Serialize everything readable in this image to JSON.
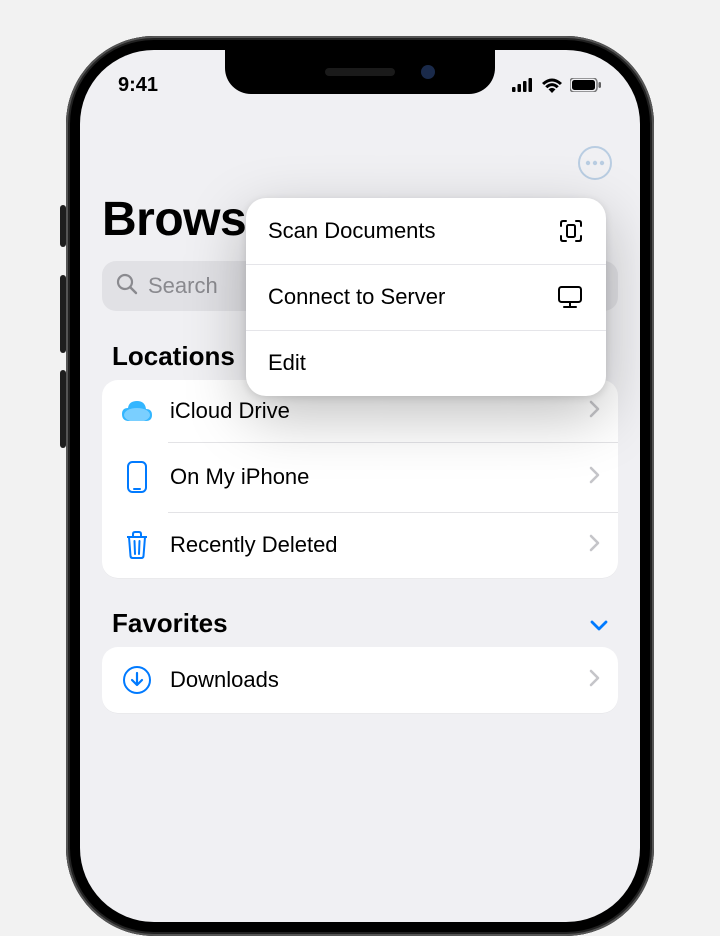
{
  "status": {
    "time": "9:41"
  },
  "header": {
    "title": "Browse",
    "search_placeholder": "Search"
  },
  "popover": {
    "items": [
      {
        "label": "Scan Documents",
        "icon": "scan"
      },
      {
        "label": "Connect to Server",
        "icon": "server"
      },
      {
        "label": "Edit",
        "icon": ""
      }
    ]
  },
  "sections": [
    {
      "title": "Locations",
      "collapsible": false,
      "items": [
        {
          "label": "iCloud Drive",
          "icon": "icloud"
        },
        {
          "label": "On My iPhone",
          "icon": "iphone"
        },
        {
          "label": "Recently Deleted",
          "icon": "trash"
        }
      ]
    },
    {
      "title": "Favorites",
      "collapsible": true,
      "items": [
        {
          "label": "Downloads",
          "icon": "download"
        }
      ]
    }
  ],
  "colors": {
    "accent": "#007aff",
    "muted_icon": "#b9cde2"
  }
}
